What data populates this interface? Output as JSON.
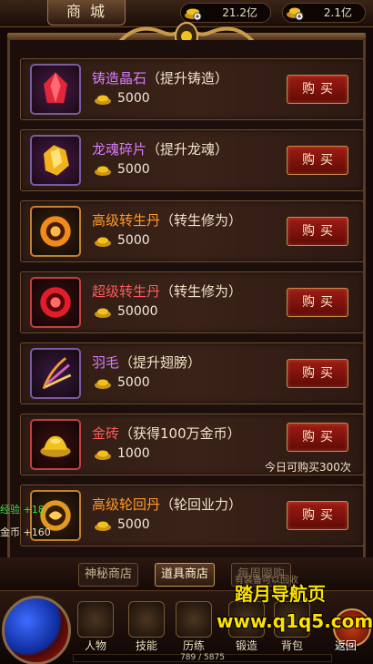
{
  "header": {
    "title": "商城",
    "currency1": "21.2亿",
    "currency2": "2.1亿"
  },
  "items": [
    {
      "name": "铸造晶石",
      "desc": "（提升铸造）",
      "price": "5000",
      "button": "购买",
      "name_color": "#d77cff",
      "icon": "red-crystal-icon",
      "accent": "#e0283a",
      "border": "#7a5aa0"
    },
    {
      "name": "龙魂碎片",
      "desc": "（提升龙魂）",
      "price": "5000",
      "button": "购买",
      "name_color": "#d77cff",
      "icon": "gold-shard-icon",
      "accent": "#f2b21c",
      "border": "#7a5aa0"
    },
    {
      "name": "高级转生丹",
      "desc": "（转生修为）",
      "price": "5000",
      "button": "购买",
      "name_color": "#ff9a2a",
      "icon": "orange-orb-icon",
      "accent": "#f08a1a",
      "border": "#c08030"
    },
    {
      "name": "超级转生丹",
      "desc": "（转生修为）",
      "price": "50000",
      "button": "购买",
      "name_color": "#ff5a5a",
      "icon": "red-orb-icon",
      "accent": "#e01e2a",
      "border": "#c04040"
    },
    {
      "name": "羽毛",
      "desc": "（提升翅膀）",
      "price": "5000",
      "button": "购买",
      "name_color": "#d77cff",
      "icon": "feather-icon",
      "accent": "#f0a030",
      "border": "#7a5aa0"
    },
    {
      "name": "金砖",
      "desc": "（获得100万金币）",
      "price": "1000",
      "button": "购买",
      "name_color": "#ff5a5a",
      "icon": "gold-brick-icon",
      "accent": "#f2c21c",
      "border": "#c04040",
      "limit": "今日可购买300次"
    },
    {
      "name": "高级轮回丹",
      "desc": "（轮回业力）",
      "price": "5000",
      "button": "购买",
      "name_color": "#ff9a2a",
      "icon": "samsara-pill-icon",
      "accent": "#e09a20",
      "border": "#c08030"
    }
  ],
  "tabs": {
    "mystic": "神秘商店",
    "props": "道具商店",
    "weekly": "每周限购",
    "overlay": "有装备可以回收"
  },
  "side": {
    "exp": "经验 +18",
    "gold": "金币 +160"
  },
  "watermark": {
    "line1": "踏月导航页",
    "line2": "www.q1q5.com"
  },
  "nav": {
    "character": "人物",
    "skills": "技能",
    "training": "历练",
    "forge": "锻造",
    "bag": "背包",
    "back": "返回"
  },
  "xp": "789 / 5875",
  "colors": {
    "gold": "#f2c21c",
    "button": "#9e1c14"
  }
}
